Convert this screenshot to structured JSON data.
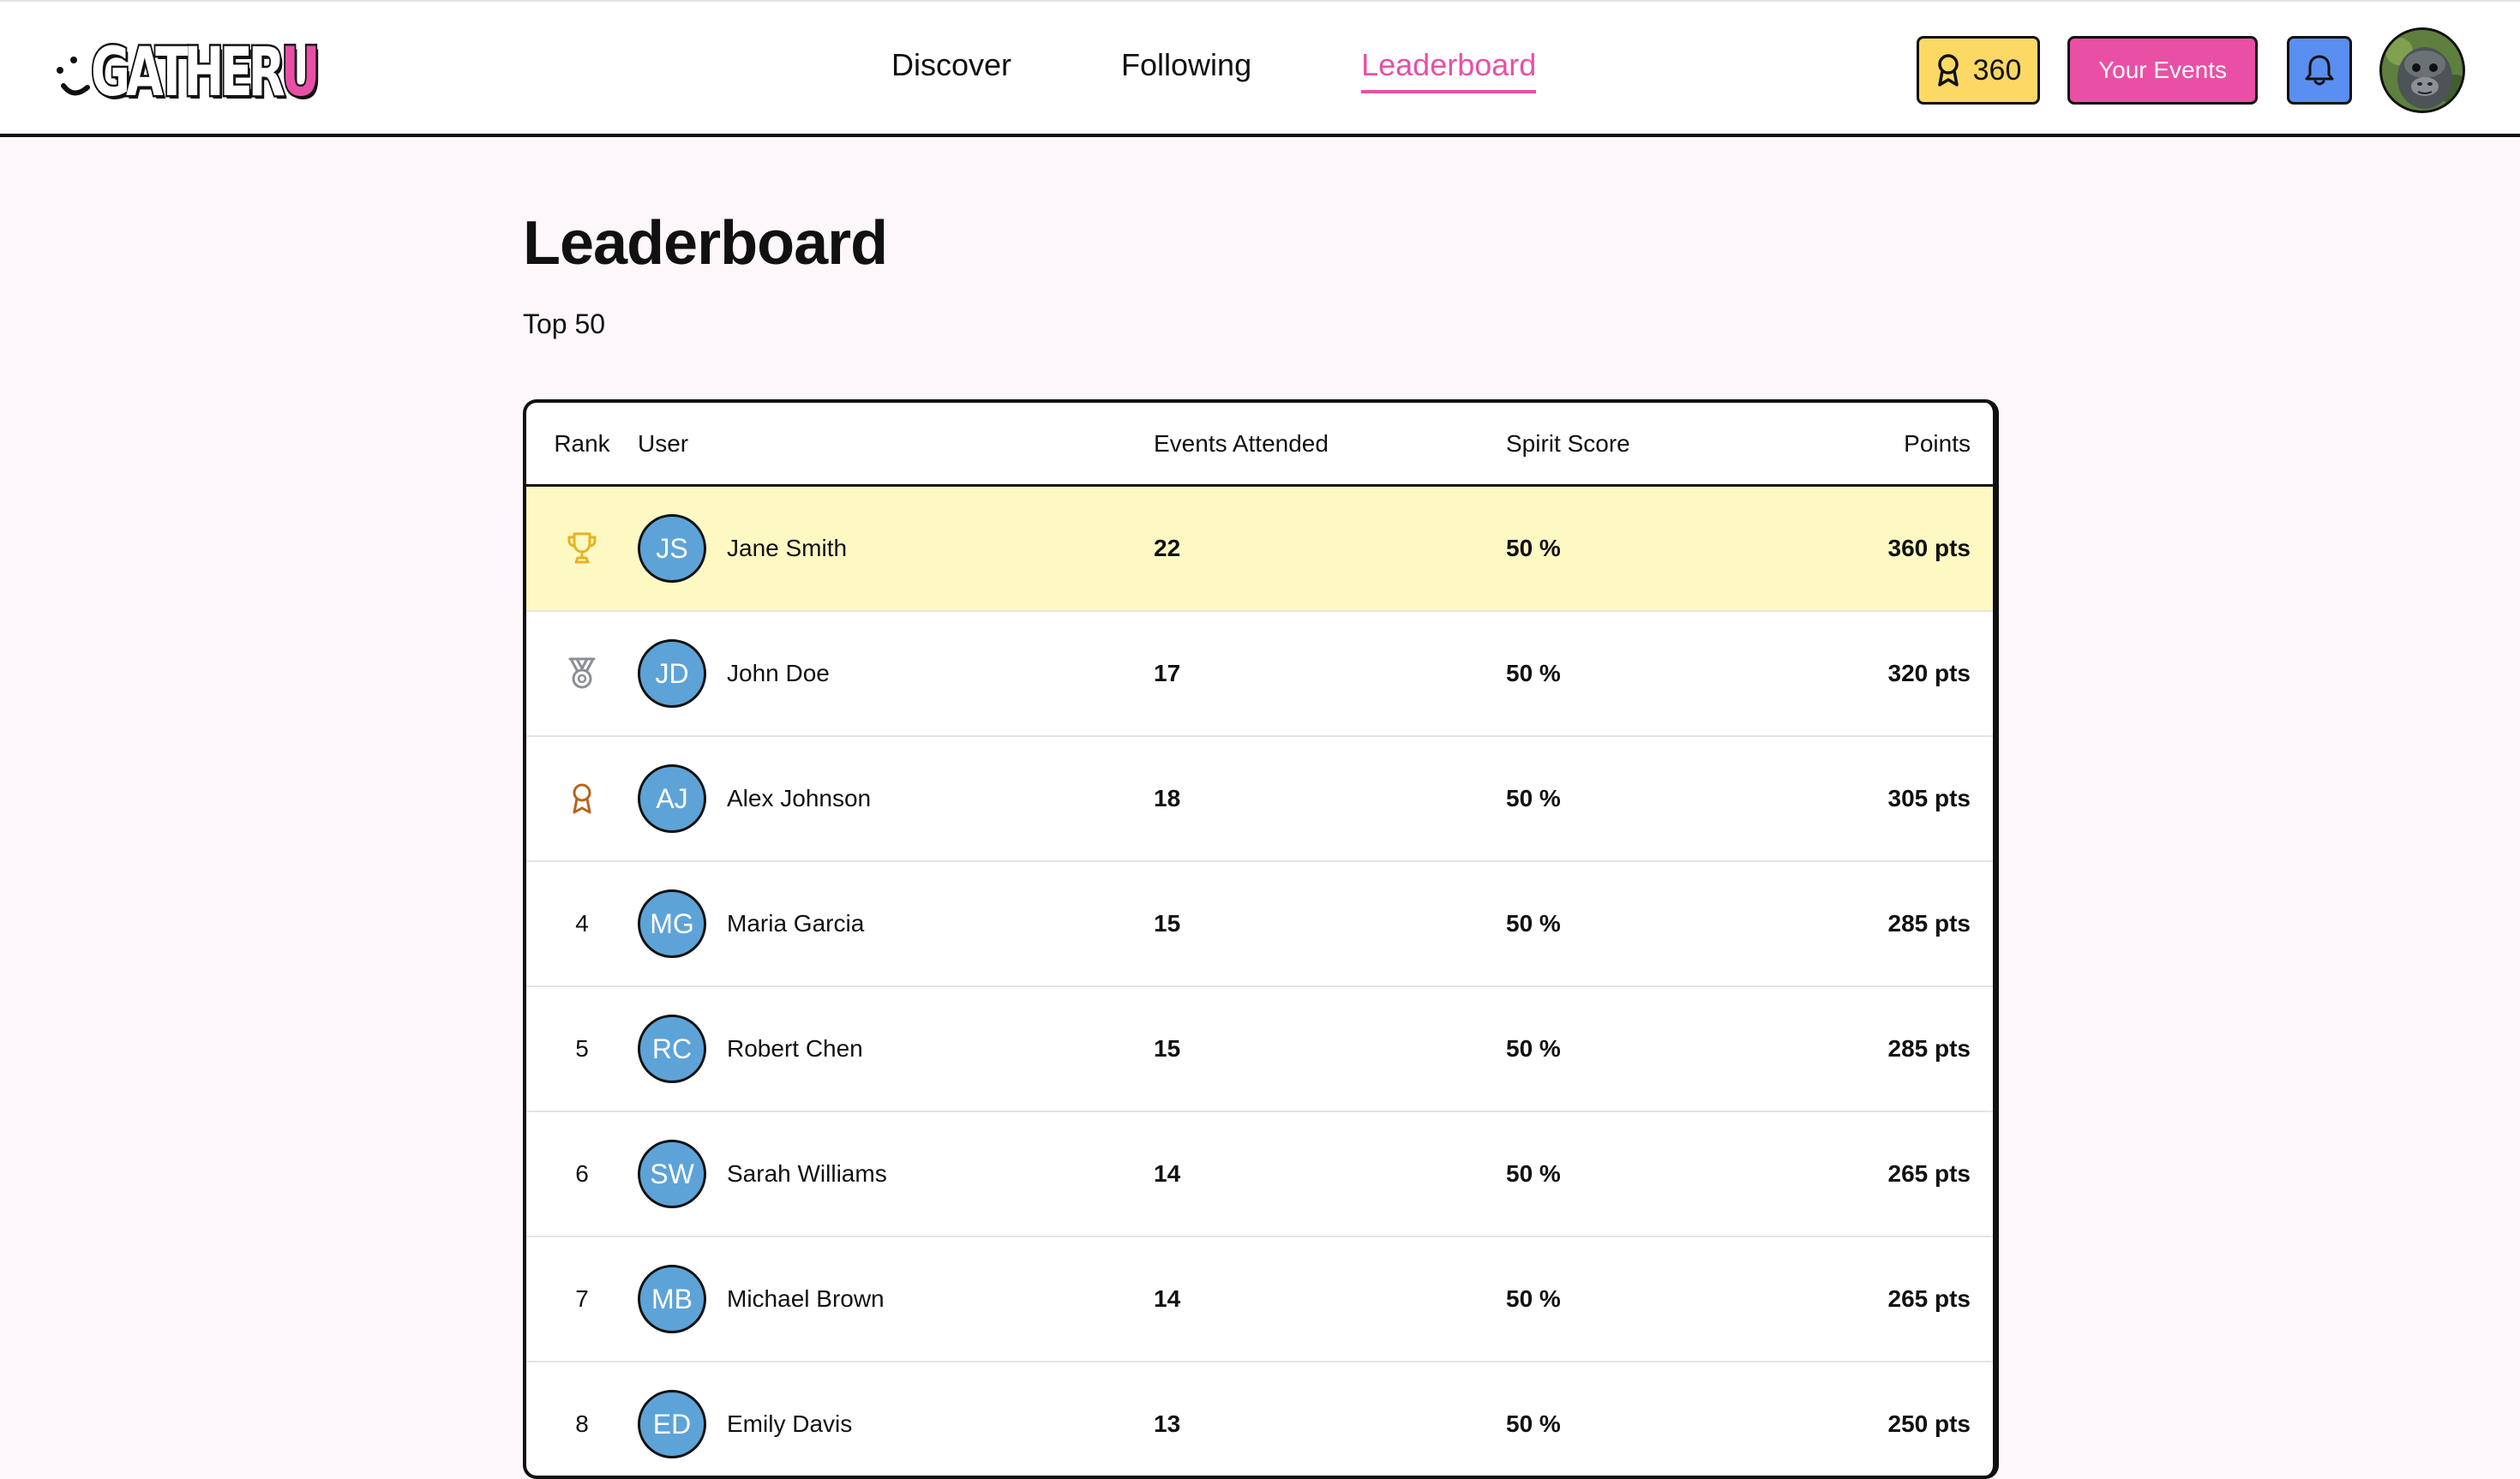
{
  "header": {
    "logo_text": "GATHER",
    "logo_text_accent": "U",
    "nav": [
      {
        "label": "Discover",
        "active": false
      },
      {
        "label": "Following",
        "active": false
      },
      {
        "label": "Leaderboard",
        "active": true
      }
    ],
    "points": "360",
    "your_events_label": "Your Events",
    "bell_icon": "bell-icon",
    "points_icon": "award-icon"
  },
  "page": {
    "title": "Leaderboard",
    "subtitle": "Top 50"
  },
  "table": {
    "columns": {
      "rank": "Rank",
      "user": "User",
      "events": "Events Attended",
      "spirit": "Spirit Score",
      "points": "Points"
    },
    "rows": [
      {
        "rank": "1",
        "rank_icon": "trophy-icon",
        "initials": "JS",
        "name": "Jane Smith",
        "events": "22",
        "spirit": "50 %",
        "points": "360 pts"
      },
      {
        "rank": "2",
        "rank_icon": "medal-icon",
        "initials": "JD",
        "name": "John Doe",
        "events": "17",
        "spirit": "50 %",
        "points": "320 pts"
      },
      {
        "rank": "3",
        "rank_icon": "award-icon",
        "initials": "AJ",
        "name": "Alex Johnson",
        "events": "18",
        "spirit": "50 %",
        "points": "305 pts"
      },
      {
        "rank": "4",
        "initials": "MG",
        "name": "Maria Garcia",
        "events": "15",
        "spirit": "50 %",
        "points": "285 pts"
      },
      {
        "rank": "5",
        "initials": "RC",
        "name": "Robert Chen",
        "events": "15",
        "spirit": "50 %",
        "points": "285 pts"
      },
      {
        "rank": "6",
        "initials": "SW",
        "name": "Sarah Williams",
        "events": "14",
        "spirit": "50 %",
        "points": "265 pts"
      },
      {
        "rank": "7",
        "initials": "MB",
        "name": "Michael Brown",
        "events": "14",
        "spirit": "50 %",
        "points": "265 pts"
      },
      {
        "rank": "8",
        "initials": "ED",
        "name": "Emily Davis",
        "events": "13",
        "spirit": "50 %",
        "points": "250 pts"
      }
    ]
  },
  "colors": {
    "accent_pink": "#e94fa6",
    "gold_chip": "#fcd864",
    "bell_blue": "#5b8ef1",
    "avatar_blue": "#5da3d8",
    "first_row_highlight": "#fef8c3",
    "page_bg": "#fdf7fb",
    "trophy_gold": "#e6b422",
    "medal_silver": "#8a8f96",
    "award_bronze": "#b5651d"
  }
}
